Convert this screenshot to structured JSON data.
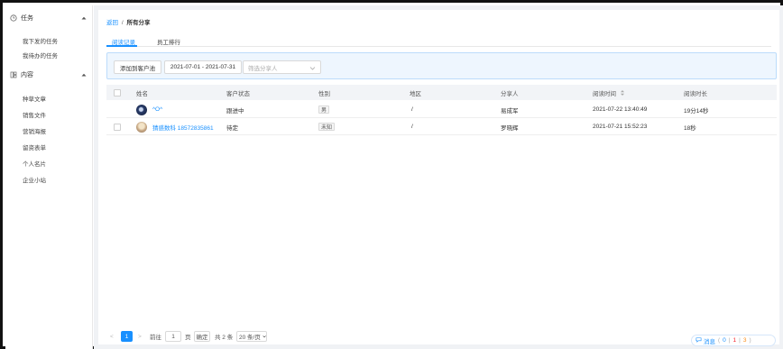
{
  "sidebar": {
    "groups": [
      {
        "title": "任务",
        "icon": "clock-icon",
        "items": [
          {
            "label": "我下发的任务"
          },
          {
            "label": "我待办的任务"
          }
        ]
      },
      {
        "title": "内容",
        "icon": "content-icon",
        "items": [
          {
            "label": "种草文章"
          },
          {
            "label": "销售文件"
          },
          {
            "label": "营销海报"
          },
          {
            "label": "留资表单"
          },
          {
            "label": "个人名片"
          },
          {
            "label": "企业小站"
          }
        ]
      }
    ]
  },
  "breadcrumb": {
    "back": "返回",
    "separator": "/",
    "current": "所有分享"
  },
  "tabs": [
    {
      "label": "阅读记录",
      "active": true
    },
    {
      "label": "员工排行",
      "active": false
    }
  ],
  "filters": {
    "add_button": "添加到客户池",
    "date_range": "2021-07-01 - 2021-07-31",
    "sharer_placeholder": "筛选分享人"
  },
  "table": {
    "columns": [
      "姓名",
      "客户状态",
      "性别",
      "地区",
      "分享人",
      "阅读时间",
      "阅读时长"
    ],
    "rows": [
      {
        "name": "^O^",
        "status": "跟进中",
        "gender": "男",
        "region": "/",
        "sharer": "易成军",
        "read_time": "2021-07-22 13:40:49",
        "duration": "19分14秒",
        "has_checkbox": false
      },
      {
        "name": "猜惑数科 18572835861",
        "status": "待定",
        "gender": "未知",
        "region": "/",
        "sharer": "罗晓辉",
        "read_time": "2021-07-21 15:52:23",
        "duration": "18秒",
        "has_checkbox": true
      }
    ]
  },
  "pagination": {
    "prev": "<",
    "current_page": "1",
    "next": ">",
    "goto_label": "前往",
    "goto_value": "1",
    "page_suffix": "页",
    "confirm": "确定",
    "total": "共 2 条",
    "page_size": "20 条/页"
  },
  "message_widget": {
    "label": "消息",
    "open": "(",
    "count_blue": "0",
    "sep": "|",
    "count_red": "1",
    "count_orange": "3",
    "close": ")"
  },
  "colors": {
    "accent": "#1890ff",
    "sidebar_bg": "#ffffff",
    "content_bg": "#f0f2f5",
    "filter_bg": "#eef6fe"
  }
}
